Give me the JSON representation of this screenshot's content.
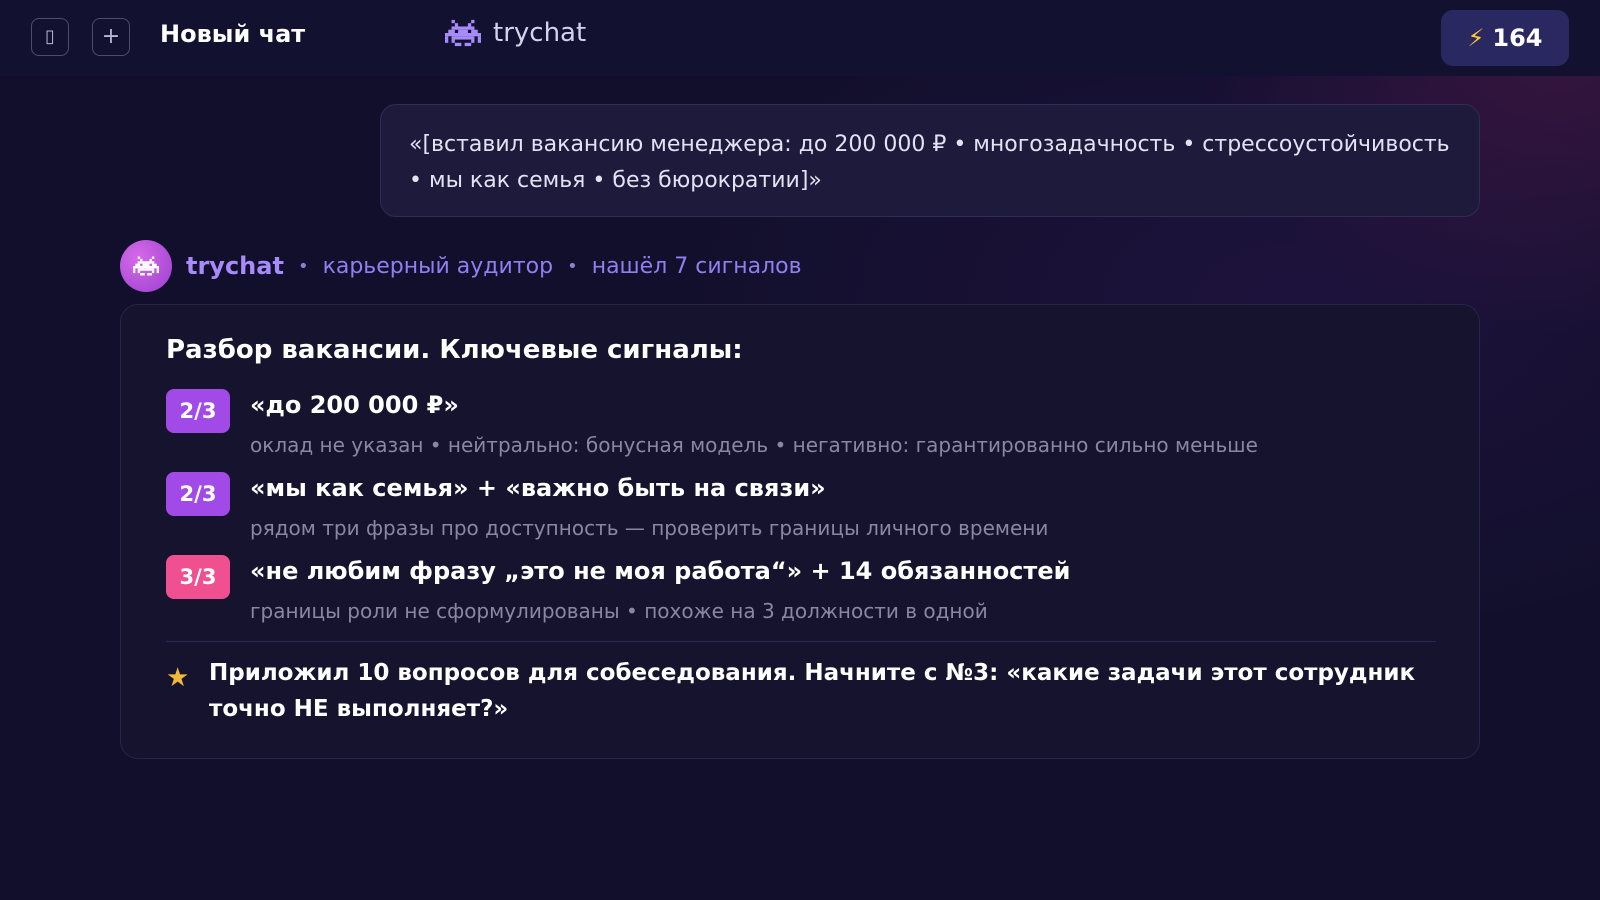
{
  "header": {
    "sidebar_icon": "sidebar-toggle-icon",
    "sidebar_glyph": "▯",
    "new_chat_icon": "plus-icon",
    "new_chat_glyph": "+",
    "chat_title": "Новый чат",
    "brand_icon": "space-invader-icon",
    "brand_name": "trychat",
    "credits_icon": "lightning-icon",
    "credits_glyph": "⚡",
    "credits_value": "164"
  },
  "user_message": {
    "text": "«[вставил вакансию менеджера: до 200 000 ₽ • многозадачность • стрессоустойчивость • мы как семья • без бюрократии]»"
  },
  "bot": {
    "avatar_icon": "space-invader-icon",
    "name": "trychat",
    "role": "карьерный аудитор",
    "summary": "нашёл 7 сигналов",
    "separator": "•"
  },
  "answer": {
    "title": "Разбор вакансии. Ключевые сигналы:",
    "signals": [
      {
        "badge": "2/3",
        "title": "«до 200 000 ₽»",
        "description": "оклад не указан • нейтрально: бонусная модель • негативно: гарантированно сильно меньше"
      },
      {
        "badge": "2/3",
        "title": "«мы как семья» + «важно быть на связи»",
        "description": "рядом три фразы про доступность — проверить границы личного времени"
      },
      {
        "badge": "3/3",
        "title": "«не любим фразу „это не моя работа“» + 14 обязанностей",
        "description": "границы роли не сформулированы • похоже на 3 должности в одной"
      }
    ],
    "footer_icon": "star-icon",
    "footer_glyph": "★",
    "footer_note": "Приложил 10 вопросов для собеседования. Начните с №3: «какие задачи этот сотрудник точно НЕ выполняет?»"
  },
  "colors": {
    "background": "#120f2c",
    "accent": "#a78bfa",
    "badge_medium": "#a24ae8",
    "badge_high": "#f0508f",
    "star": "#f0b93a",
    "bolt": "#ffc93c"
  }
}
